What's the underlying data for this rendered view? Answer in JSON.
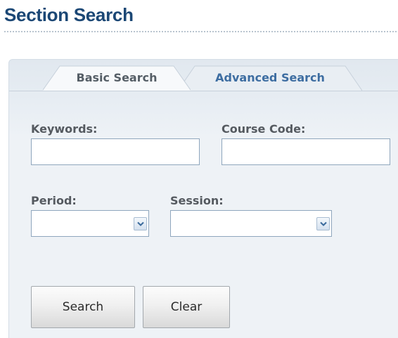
{
  "header": {
    "title": "Section Search"
  },
  "tabs": [
    {
      "label": "Basic Search",
      "selected": true
    },
    {
      "label": "Advanced Search",
      "selected": false
    }
  ],
  "form": {
    "keywords": {
      "label": "Keywords:",
      "value": "",
      "placeholder": ""
    },
    "course_code": {
      "label": "Course Code:",
      "value": "",
      "placeholder": ""
    },
    "period": {
      "label": "Period:",
      "selected": ""
    },
    "session": {
      "label": "Session:",
      "selected": ""
    }
  },
  "buttons": {
    "search": "Search",
    "clear": "Clear"
  },
  "colors": {
    "title": "#1b4775",
    "tab_active_text": "#555e66",
    "tab_inactive_text": "#3d6da1",
    "panel_background": "#eef2f6",
    "input_border": "#8fa6bd"
  },
  "icons": {
    "dropdown": "chevron-down-icon"
  }
}
